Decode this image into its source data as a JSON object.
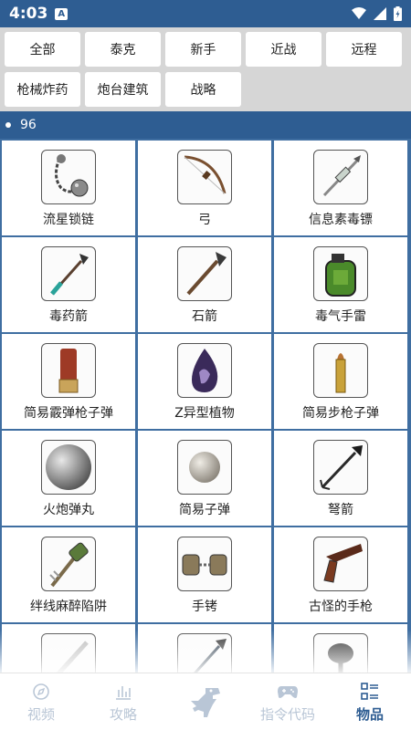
{
  "status_bar": {
    "time": "4:03",
    "notification_icon": "A"
  },
  "filters": [
    {
      "label": "全部"
    },
    {
      "label": "泰克"
    },
    {
      "label": "新手"
    },
    {
      "label": "近战"
    },
    {
      "label": "远程"
    },
    {
      "label": "枪械炸药"
    },
    {
      "label": "炮台建筑"
    },
    {
      "label": "战略"
    }
  ],
  "count_bar": {
    "count": "96"
  },
  "items": [
    {
      "label": "流星锁链",
      "icon": "chain-flail-icon"
    },
    {
      "label": "弓",
      "icon": "bow-icon"
    },
    {
      "label": "信息素毒镖",
      "icon": "pheromone-dart-icon"
    },
    {
      "label": "毒药箭",
      "icon": "poison-arrow-icon"
    },
    {
      "label": "石箭",
      "icon": "stone-arrow-icon"
    },
    {
      "label": "毒气手雷",
      "icon": "gas-grenade-icon"
    },
    {
      "label": "简易霰弹枪子弹",
      "icon": "shotgun-shell-icon"
    },
    {
      "label": "Z异型植物",
      "icon": "z-plant-seed-icon"
    },
    {
      "label": "简易步枪子弹",
      "icon": "rifle-bullet-icon"
    },
    {
      "label": "火炮弹丸",
      "icon": "cannon-ball-icon"
    },
    {
      "label": "简易子弹",
      "icon": "simple-bullet-icon"
    },
    {
      "label": "弩箭",
      "icon": "crossbow-bolt-icon"
    },
    {
      "label": "绊线麻醉陷阱",
      "icon": "tripwire-trap-icon"
    },
    {
      "label": "手铐",
      "icon": "handcuffs-icon"
    },
    {
      "label": "古怪的手枪",
      "icon": "flare-gun-icon"
    },
    {
      "label": "",
      "icon": "sword-icon"
    },
    {
      "label": "",
      "icon": "pike-icon"
    },
    {
      "label": "",
      "icon": "pan-icon"
    }
  ],
  "nav": [
    {
      "label": "视频",
      "icon": "compass-icon"
    },
    {
      "label": "攻略",
      "icon": "chart-icon"
    },
    {
      "label": "",
      "icon": "dino-icon"
    },
    {
      "label": "指令代码",
      "icon": "gamepad-icon"
    },
    {
      "label": "物品",
      "icon": "grid-list-icon"
    }
  ],
  "colors": {
    "primary": "#2e5d92",
    "grid_line": "#3f6ea1",
    "filter_bg": "#d6d6d6",
    "nav_inactive": "#b9c6d6"
  }
}
